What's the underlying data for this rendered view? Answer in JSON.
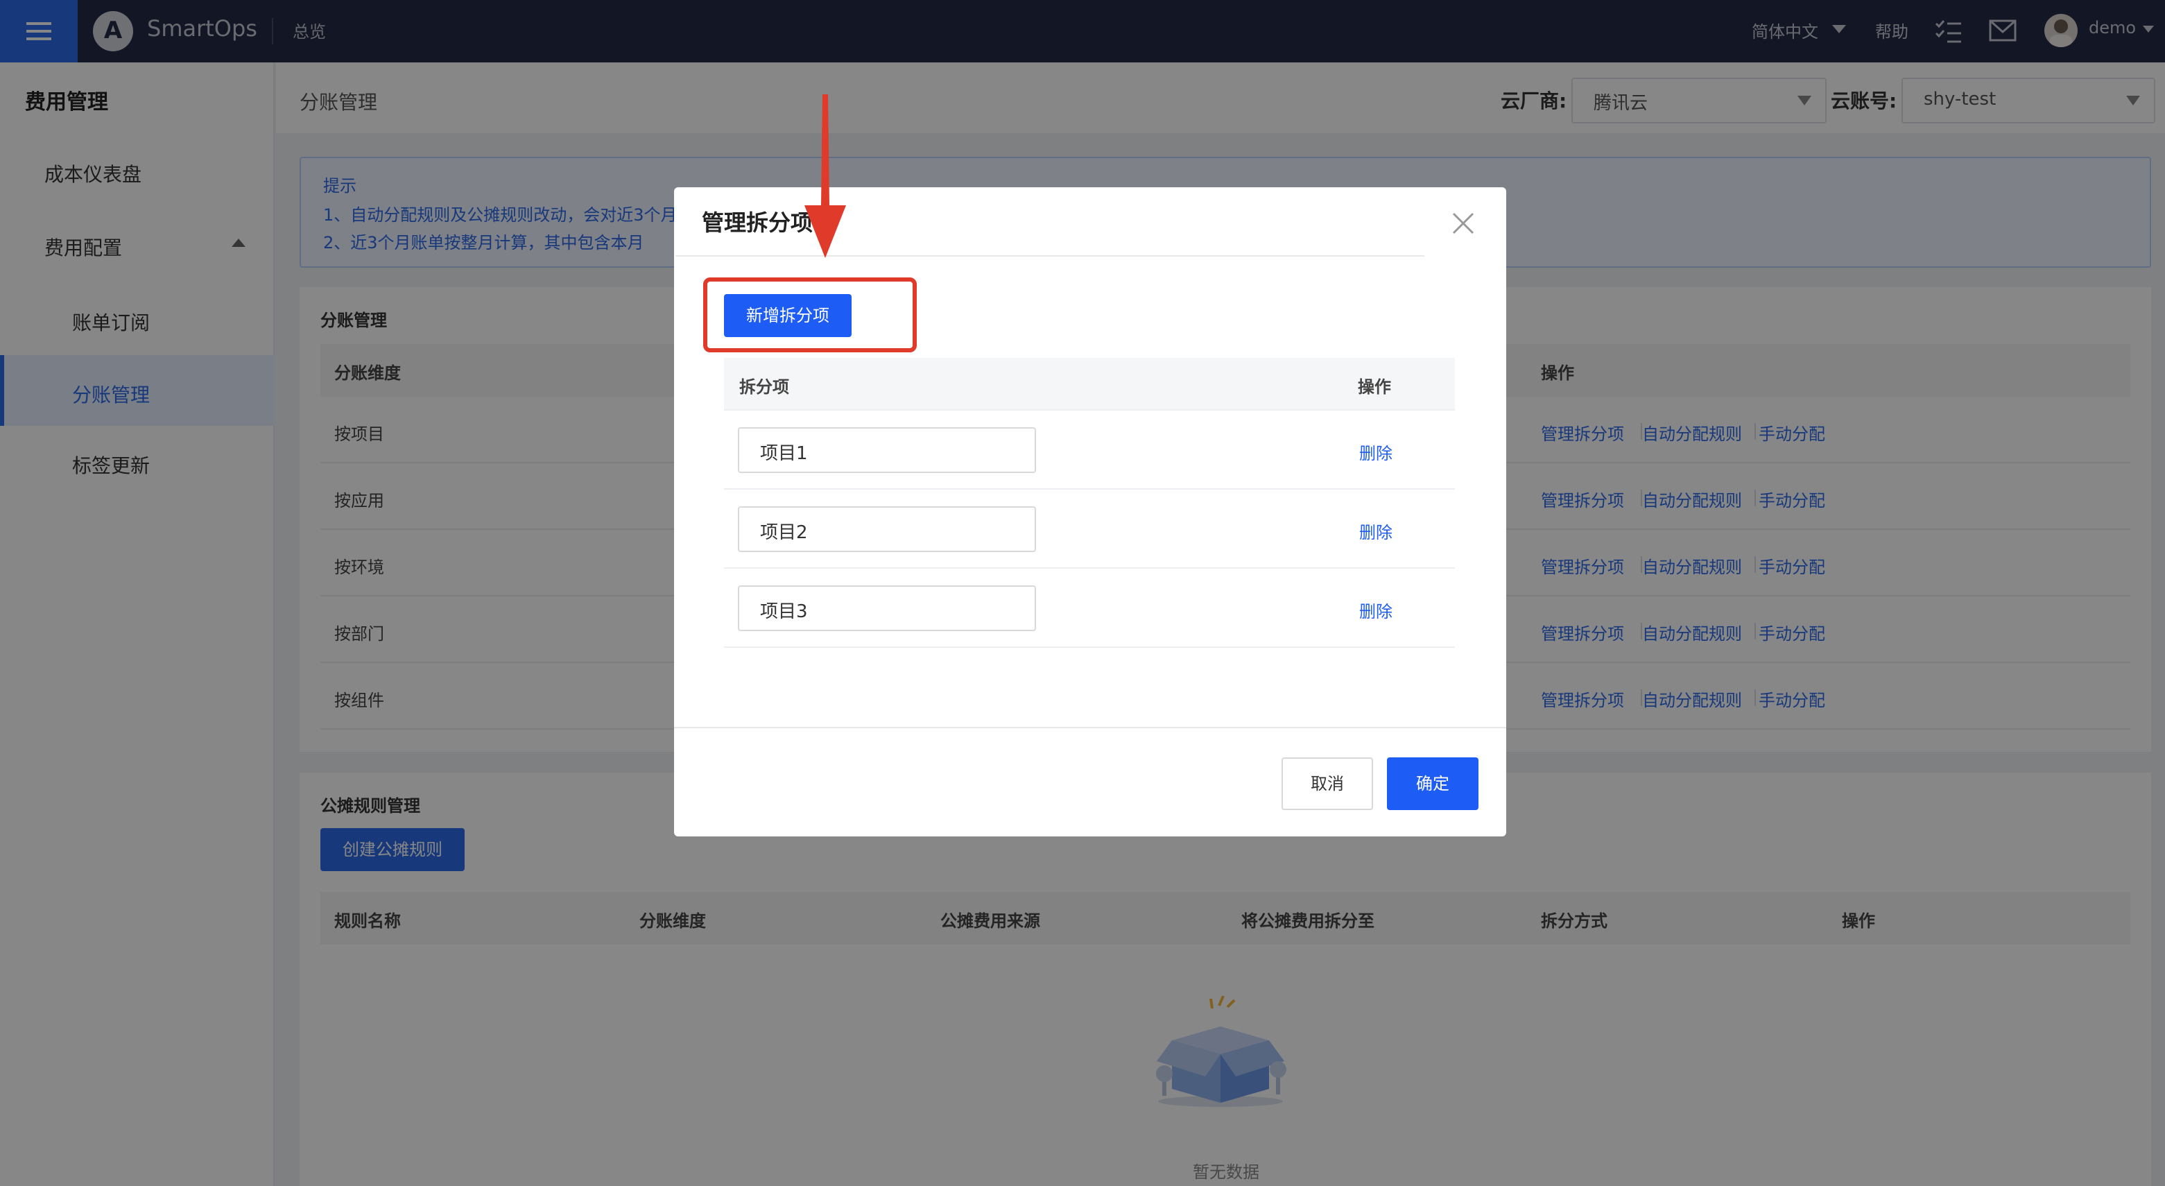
{
  "topbar": {
    "brand": "SmartOps",
    "overview": "总览",
    "language": "简体中文",
    "help": "帮助",
    "username": "demo"
  },
  "sidebar": {
    "title": "费用管理",
    "items": [
      {
        "label": "成本仪表盘"
      },
      {
        "label": "费用配置"
      },
      {
        "label": "账单订阅"
      },
      {
        "label": "分账管理"
      },
      {
        "label": "标签更新"
      }
    ]
  },
  "header": {
    "breadcrumb": "分账管理",
    "cloud_vendor_label": "云厂商:",
    "cloud_vendor_value": "腾讯云",
    "cloud_account_label": "云账号:",
    "cloud_account_value": "shy-test"
  },
  "tips": {
    "title": "提示",
    "line1": "1、自动分配规则及公摊规则改动，会对近3个月",
    "line2": "2、近3个月账单按整月计算，其中包含本月"
  },
  "split_card": {
    "title": "分账管理",
    "col_dimension": "分账维度",
    "col_action": "操作",
    "rows": [
      {
        "dimension": "按项目"
      },
      {
        "dimension": "按应用"
      },
      {
        "dimension": "按环境"
      },
      {
        "dimension": "按部门"
      },
      {
        "dimension": "按组件"
      }
    ],
    "actions": [
      "管理拆分项",
      "自动分配规则",
      "手动分配"
    ]
  },
  "rule_card": {
    "title": "公摊规则管理",
    "create_button": "创建公摊规则",
    "columns": [
      "规则名称",
      "分账维度",
      "公摊费用来源",
      "将公摊费用拆分至",
      "拆分方式",
      "操作"
    ],
    "empty_text": "暂无数据"
  },
  "modal": {
    "title": "管理拆分项",
    "add_button": "新增拆分项",
    "col_item": "拆分项",
    "col_action": "操作",
    "items": [
      {
        "value": "项目1",
        "action": "删除"
      },
      {
        "value": "项目2",
        "action": "删除"
      },
      {
        "value": "项目3",
        "action": "删除"
      }
    ],
    "cancel": "取消",
    "confirm": "确定"
  },
  "colors": {
    "primary": "#1e5df5",
    "topbar": "#252a47",
    "annotation": "#e03a2b"
  }
}
